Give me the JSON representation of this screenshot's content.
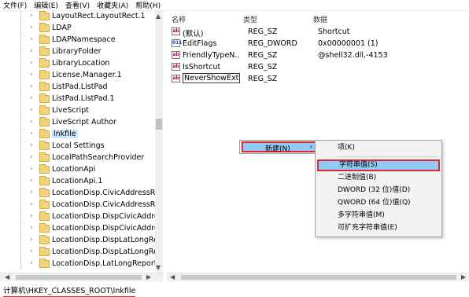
{
  "menubar": {
    "items": [
      "文件(F)",
      "编辑(E)",
      "查看(V)",
      "收藏夹(A)",
      "帮助(H)"
    ]
  },
  "tree": {
    "items": [
      {
        "label": "LayoutRect.LayoutRect.1"
      },
      {
        "label": "LDAP"
      },
      {
        "label": "LDAPNamespace"
      },
      {
        "label": "LibraryFolder"
      },
      {
        "label": "LibraryLocation"
      },
      {
        "label": "License.Manager.1"
      },
      {
        "label": "ListPad.ListPad"
      },
      {
        "label": "ListPad.ListPad.1"
      },
      {
        "label": "LiveScript"
      },
      {
        "label": "LiveScript Author"
      },
      {
        "label": "lnkfile"
      },
      {
        "label": "Local Settings"
      },
      {
        "label": "LocalPathSearchProvider"
      },
      {
        "label": "LocationApi"
      },
      {
        "label": "LocationApi.1"
      },
      {
        "label": "LocationDisp.CivicAddressRep"
      },
      {
        "label": "LocationDisp.CivicAddressRep"
      },
      {
        "label": "LocationDisp.DispCivicAddress"
      },
      {
        "label": "LocationDisp.DispCivicAddress"
      },
      {
        "label": "LocationDisp.DispLatLongRep"
      },
      {
        "label": "LocationDisp.DispLatLongRep"
      },
      {
        "label": "LocationDisp.LatLongReportFa"
      }
    ]
  },
  "list": {
    "headers": {
      "name": "名称",
      "type": "类型",
      "data": "数据"
    },
    "rows": [
      {
        "icon": "string-value-icon",
        "name": "(默认)",
        "type": "REG_SZ",
        "data": "Shortcut"
      },
      {
        "icon": "binary-value-icon",
        "name": "EditFlags",
        "type": "REG_DWORD",
        "data": "0x00000001 (1)"
      },
      {
        "icon": "string-value-icon",
        "name": "FriendlyTypeN...",
        "type": "REG_SZ",
        "data": "@shell32.dll,-4153"
      },
      {
        "icon": "string-value-icon",
        "name": "IsShortcut",
        "type": "REG_SZ",
        "data": ""
      },
      {
        "icon": "string-value-icon",
        "name": "NeverShowExt",
        "type": "REG_SZ",
        "data": ""
      }
    ]
  },
  "context_menu": {
    "new_label": "新建(N)",
    "arrow": "›"
  },
  "submenu": {
    "items": [
      "项(K)",
      "字符串值(S)",
      "二进制值(B)",
      "DWORD (32 位)值(D)",
      "QWORD (64 位)值(Q)",
      "多字符串值(M)",
      "可扩充字符串值(E)"
    ]
  },
  "status": {
    "path": "计算机\\HKEY_CLASSES_ROOT\\lnkfile"
  },
  "icon_glyphs": {
    "string": "ab",
    "binary": "011"
  },
  "colors": {
    "highlight": "#91c9f7",
    "annotation_red": "#e0282a",
    "folder": "#f2d377"
  }
}
